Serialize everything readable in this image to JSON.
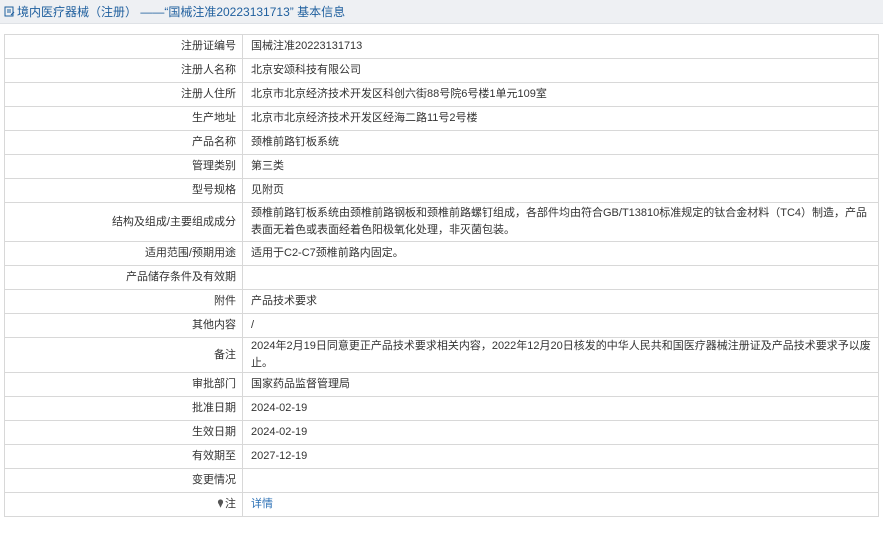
{
  "header": {
    "title": "境内医疗器械（注册） ——“国械注准20223131713” 基本信息",
    "icon": "document-edit-icon"
  },
  "rows": [
    {
      "label": "注册证编号",
      "value": "国械注准20223131713"
    },
    {
      "label": "注册人名称",
      "value": "北京安颂科技有限公司"
    },
    {
      "label": "注册人住所",
      "value": "北京市北京经济技术开发区科创六街88号院6号楼1单元109室"
    },
    {
      "label": "生产地址",
      "value": "北京市北京经济技术开发区经海二路11号2号楼"
    },
    {
      "label": "产品名称",
      "value": "颈椎前路钉板系统"
    },
    {
      "label": "管理类别",
      "value": "第三类"
    },
    {
      "label": "型号规格",
      "value": "见附页"
    },
    {
      "label": "结构及组成/主要组成成分",
      "value": "颈椎前路钉板系统由颈椎前路钢板和颈椎前路螺钉组成，各部件均由符合GB/T13810标准规定的钛合金材料（TC4）制造，产品表面无着色或表面经着色阳极氧化处理，非灭菌包装。"
    },
    {
      "label": "适用范围/预期用途",
      "value": "适用于C2-C7颈椎前路内固定。"
    },
    {
      "label": "产品储存条件及有效期",
      "value": ""
    },
    {
      "label": "附件",
      "value": "产品技术要求"
    },
    {
      "label": "其他内容",
      "value": "/"
    },
    {
      "label": "备注",
      "value": "2024年2月19日同意更正产品技术要求相关内容，2022年12月20日核发的中华人民共和国医疗器械注册证及产品技术要求予以废止。"
    },
    {
      "label": "审批部门",
      "value": "国家药品监督管理局"
    },
    {
      "label": "批准日期",
      "value": "2024-02-19"
    },
    {
      "label": "生效日期",
      "value": "2024-02-19"
    },
    {
      "label": "有效期至",
      "value": "2027-12-19"
    },
    {
      "label": "变更情况",
      "value": ""
    }
  ],
  "note_row": {
    "label": "注",
    "icon": "pin-icon",
    "link": "详情",
    "link_color": "#2a6fb5"
  },
  "colors": {
    "title": "#1f5f9e",
    "border": "#d8d8d8",
    "header_bg": "#eef0f3"
  }
}
